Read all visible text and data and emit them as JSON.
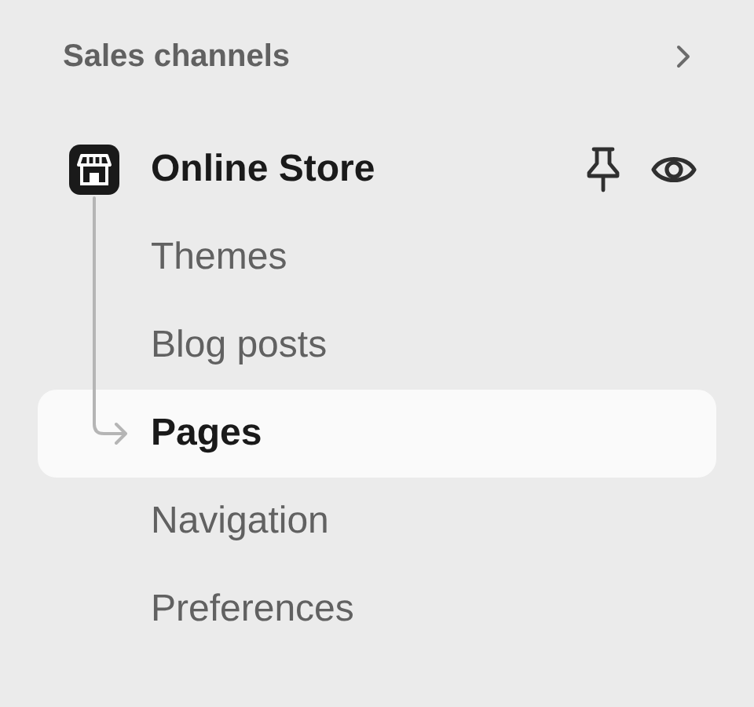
{
  "section": {
    "title": "Sales channels"
  },
  "channel": {
    "name": "Online Store"
  },
  "items": [
    {
      "label": "Themes",
      "selected": false
    },
    {
      "label": "Blog posts",
      "selected": false
    },
    {
      "label": "Pages",
      "selected": true
    },
    {
      "label": "Navigation",
      "selected": false
    },
    {
      "label": "Preferences",
      "selected": false
    }
  ]
}
